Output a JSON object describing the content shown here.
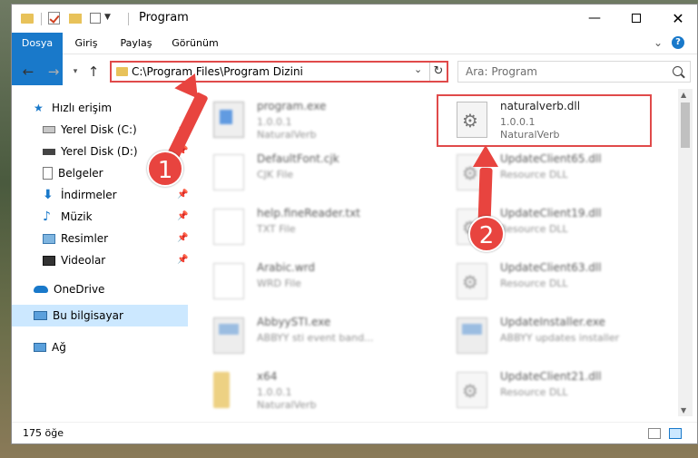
{
  "window": {
    "title": "Program"
  },
  "ribbon": {
    "tabs": [
      "Dosya",
      "Giriş",
      "Paylaş",
      "Görünüm"
    ]
  },
  "nav": {
    "address": "C:\\Program Files\\Program Dizini",
    "search_placeholder": "Ara: Program"
  },
  "sidebar": {
    "items": [
      {
        "label": "Hızlı erişim",
        "icon": "star-icon"
      },
      {
        "label": "Yerel Disk (C:)",
        "icon": "disk-icon"
      },
      {
        "label": "Yerel Disk (D:)",
        "icon": "disk-icon"
      },
      {
        "label": "Belgeler",
        "icon": "document-icon"
      },
      {
        "label": "İndirmeler",
        "icon": "download-icon"
      },
      {
        "label": "Müzik",
        "icon": "music-icon"
      },
      {
        "label": "Resimler",
        "icon": "pictures-icon"
      },
      {
        "label": "Videolar",
        "icon": "video-icon"
      },
      {
        "label": "OneDrive",
        "icon": "cloud-icon"
      },
      {
        "label": "Bu bilgisayar",
        "icon": "computer-icon"
      },
      {
        "label": "Ağ",
        "icon": "network-icon"
      }
    ],
    "selected": "Bu bilgisayar"
  },
  "files": [
    {
      "name": "program.exe",
      "l2": "1.0.0.1",
      "l3": "NaturalVerb",
      "icon": "exe-icon"
    },
    {
      "name": "naturalverb.dll",
      "l2": "1.0.0.1",
      "l3": "NaturalVerb",
      "icon": "gear-icon"
    },
    {
      "name": "DefaultFont.cjk",
      "l2": "CJK File",
      "l3": "",
      "icon": "page-icon"
    },
    {
      "name": "UpdateClient65.dll",
      "l2": "Resource DLL",
      "l3": "",
      "icon": "gear-icon"
    },
    {
      "name": "help.fineReader.txt",
      "l2": "TXT File",
      "l3": "",
      "icon": "page-icon"
    },
    {
      "name": "UpdateClient19.dll",
      "l2": "Resource DLL",
      "l3": "",
      "icon": "gear-icon"
    },
    {
      "name": "Arabic.wrd",
      "l2": "WRD File",
      "l3": "",
      "icon": "page-icon"
    },
    {
      "name": "UpdateClient63.dll",
      "l2": "Resource DLL",
      "l3": "",
      "icon": "gear-icon"
    },
    {
      "name": "AbbyySTI.exe",
      "l2": "ABBYY sti event band...",
      "l3": "",
      "icon": "app-icon"
    },
    {
      "name": "UpdateInstaller.exe",
      "l2": "ABBYY updates installer",
      "l3": "",
      "icon": "app-icon"
    },
    {
      "name": "x64",
      "l2": "1.0.0.1",
      "l3": "NaturalVerb",
      "icon": "folder-icon"
    },
    {
      "name": "UpdateClient21.dll",
      "l2": "Resource DLL",
      "l3": "",
      "icon": "gear-icon"
    }
  ],
  "status": {
    "count": "175 öğe"
  },
  "annotations": {
    "badge1": "1",
    "badge2": "2"
  }
}
